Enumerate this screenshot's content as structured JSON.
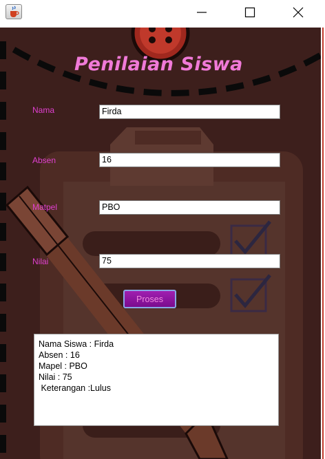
{
  "window": {
    "app_icon": "java-cup-icon",
    "controls": [
      "minimize-icon",
      "maximize-icon",
      "close-icon"
    ]
  },
  "form": {
    "title": "Penilaian Siswa",
    "fields": [
      {
        "label": "Nama",
        "value": "Firda"
      },
      {
        "label": "Absen",
        "value": "16"
      },
      {
        "label": "Matpel",
        "value": "PBO"
      },
      {
        "label": "Nilai",
        "value": "75"
      }
    ],
    "submit_label": "Proses"
  },
  "result": {
    "lines": [
      "Nama Siswa : Firda",
      "Absen : 16",
      "Mapel : PBO",
      "Nilai : 75",
      " Keterangan :Lulus"
    ]
  },
  "colors": {
    "background": "#3d1f1c",
    "label": "#e040d0",
    "title": "#f07ad8",
    "button": "#8e159f"
  }
}
